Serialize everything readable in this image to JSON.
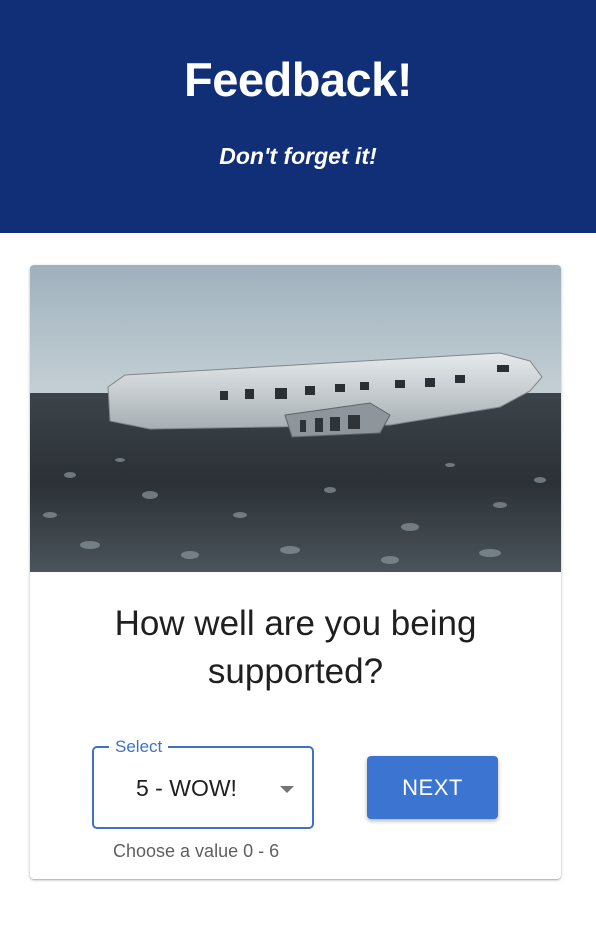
{
  "header": {
    "title": "Feedback!",
    "subtitle": "Don't forget it!",
    "background_color": "#112f76"
  },
  "card": {
    "image": {
      "description_icon": "plane-wreck-photo"
    },
    "question": "How well are you being supported?",
    "select": {
      "label": "Select",
      "value": "5 - WOW!",
      "helper_text": "Choose a value 0 - 6",
      "accent_color": "#3d72c8"
    },
    "next_button": {
      "label": "NEXT",
      "color": "#3b74d1"
    }
  }
}
